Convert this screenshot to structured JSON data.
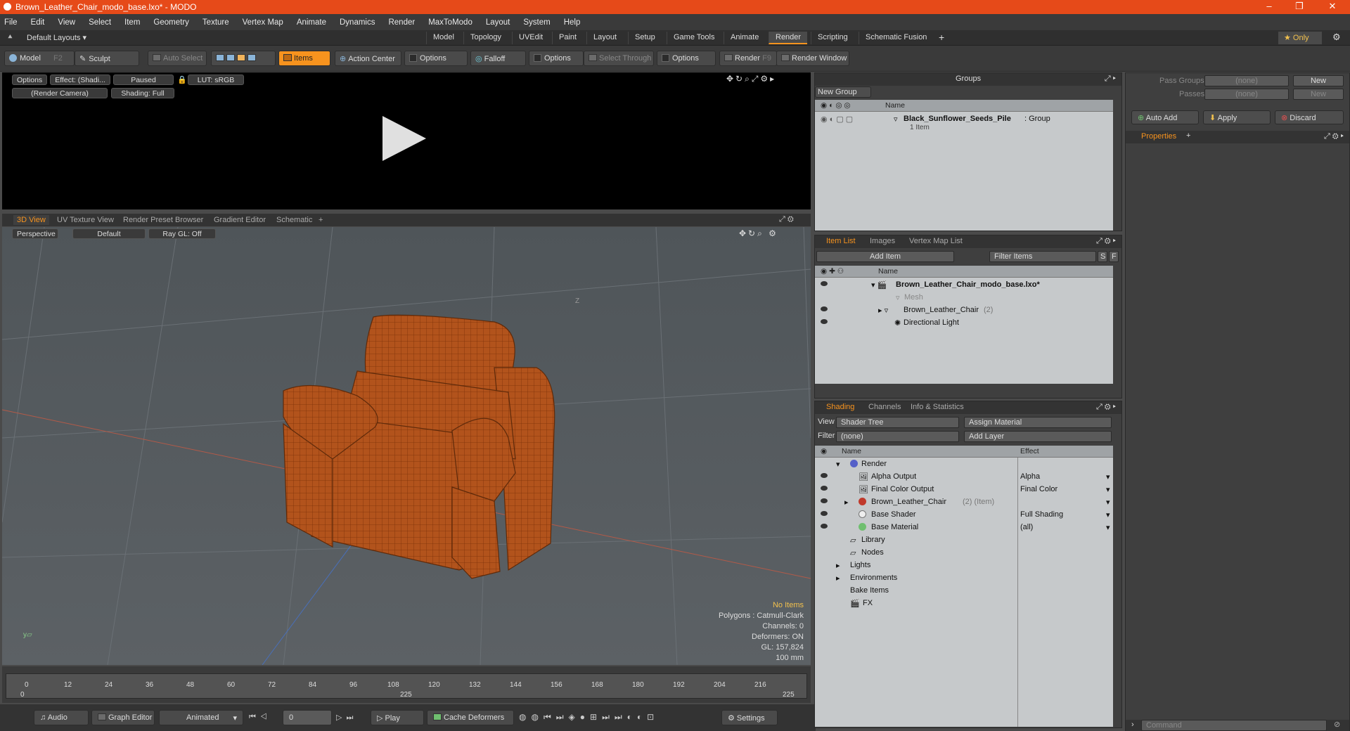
{
  "window": {
    "title": "Brown_Leather_Chair_modo_base.lxo* - MODO",
    "minimize": "–",
    "restore": "❐",
    "close": "✕"
  },
  "menu": [
    "File",
    "Edit",
    "View",
    "Select",
    "Item",
    "Geometry",
    "Texture",
    "Vertex Map",
    "Animate",
    "Dynamics",
    "Render",
    "MaxToModo",
    "Layout",
    "System",
    "Help"
  ],
  "layouts": {
    "dropdown": "Default Layouts ▾",
    "tabs": [
      "Model",
      "Topology",
      "UVEdit",
      "Paint",
      "Layout",
      "Setup",
      "Game Tools",
      "Animate",
      "Render",
      "Scripting",
      "Schematic Fusion"
    ],
    "active": "Render",
    "add": "+",
    "only": "★ Only"
  },
  "toolbar": {
    "model": "Model",
    "model_key": "F2",
    "sculpt": "Sculpt",
    "auto_select": "Auto Select",
    "items": "Items",
    "action_center": "Action Center",
    "options1": "Options",
    "falloff": "Falloff",
    "options2": "Options",
    "select_through": "Select Through",
    "options3": "Options",
    "render": "Render",
    "render_key": "F9",
    "render_window": "Render Window"
  },
  "render_view": {
    "options": "Options",
    "effect": "Effect: (Shadi...",
    "paused": "Paused",
    "lut": "LUT: sRGB",
    "camera": "(Render Camera)",
    "shading": "Shading: Full"
  },
  "view_tabs": [
    "3D View",
    "UV Texture View",
    "Render Preset Browser",
    "Gradient Editor",
    "Schematic"
  ],
  "view3d": {
    "perspective": "Perspective",
    "default": "Default",
    "raygl": "Ray GL: Off",
    "axis_label": "Z",
    "info": {
      "no_items": "No Items",
      "polygons": "Polygons : Catmull-Clark",
      "channels": "Channels: 0",
      "deformers": "Deformers: ON",
      "gl": "GL: 157,824",
      "scale": "100 mm"
    }
  },
  "timeline": {
    "ticks": [
      "0",
      "12",
      "24",
      "36",
      "48",
      "60",
      "72",
      "84",
      "96",
      "108",
      "120",
      "132",
      "144",
      "156",
      "168",
      "180",
      "192",
      "204",
      "216"
    ],
    "start": "0",
    "mid": "225",
    "end": "225"
  },
  "bottombar": {
    "audio": "Audio",
    "graph_editor": "Graph Editor",
    "animated": "Animated",
    "frame": "0",
    "play": "Play",
    "cache": "Cache Deformers",
    "settings": "Settings"
  },
  "groups": {
    "title": "Groups",
    "new_group": "New Group",
    "col_name": "Name",
    "item_name": "Black_Sunflower_Seeds_Pile",
    "item_type": " : Group",
    "item_count": "1 Item"
  },
  "item_list": {
    "tabs": [
      "Item List",
      "Images",
      "Vertex Map List"
    ],
    "add_item": "Add Item",
    "filter": "Filter Items",
    "s": "S",
    "f": "F",
    "col_name": "Name",
    "items": [
      {
        "label": "Brown_Leather_Chair_modo_base.lxo*",
        "extra": ""
      },
      {
        "label": "Mesh",
        "extra": ""
      },
      {
        "label": "Brown_Leather_Chair",
        "extra": "(2)"
      },
      {
        "label": "Directional Light",
        "extra": ""
      }
    ]
  },
  "shading": {
    "tabs": [
      "Shading",
      "Channels",
      "Info & Statistics"
    ],
    "view_label": "View",
    "view_value": "Shader Tree",
    "assign": "Assign Material",
    "filter_label": "Filter",
    "filter_value": "(none)",
    "add_layer": "Add Layer",
    "col_name": "Name",
    "col_effect": "Effect",
    "rows": [
      {
        "name": "Render",
        "effect": "",
        "extra": ""
      },
      {
        "name": "Alpha Output",
        "effect": "Alpha",
        "extra": ""
      },
      {
        "name": "Final Color Output",
        "effect": "Final Color",
        "extra": ""
      },
      {
        "name": "Brown_Leather_Chair",
        "effect": "",
        "extra": "(2) (Item)"
      },
      {
        "name": "Base Shader",
        "effect": "Full Shading",
        "extra": ""
      },
      {
        "name": "Base Material",
        "effect": "(all)",
        "extra": ""
      },
      {
        "name": "Library",
        "effect": "",
        "extra": ""
      },
      {
        "name": "Nodes",
        "effect": "",
        "extra": ""
      },
      {
        "name": "Lights",
        "effect": "",
        "extra": ""
      },
      {
        "name": "Environments",
        "effect": "",
        "extra": ""
      },
      {
        "name": "Bake Items",
        "effect": "",
        "extra": ""
      },
      {
        "name": "FX",
        "effect": "",
        "extra": ""
      }
    ]
  },
  "passes": {
    "pass_groups": "Pass Groups",
    "passes": "Passes",
    "none": "(none)",
    "new": "New",
    "auto_add": "Auto Add",
    "apply": "Apply",
    "discard": "Discard",
    "properties": "Properties",
    "command": "Command"
  },
  "colors": {
    "accent": "#f7931e",
    "title": "#e64a19",
    "chair": "#b2531c"
  }
}
